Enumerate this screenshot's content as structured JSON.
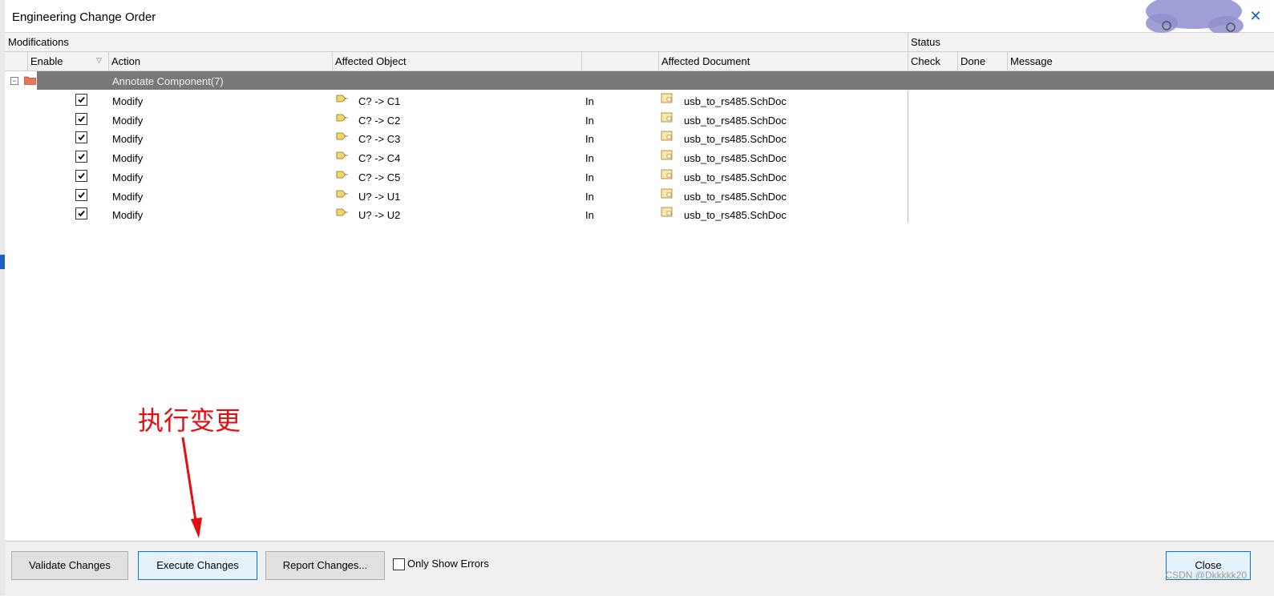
{
  "window": {
    "title": "Engineering Change Order"
  },
  "groups": {
    "modifications": "Modifications",
    "status": "Status"
  },
  "columns": {
    "enable": "Enable",
    "action": "Action",
    "affected_object": "Affected Object",
    "affected_document": "Affected Document",
    "check": "Check",
    "done": "Done",
    "message": "Message"
  },
  "group_row": {
    "label": "Annotate Component(7)",
    "expanded": true
  },
  "rows": [
    {
      "enabled": true,
      "action": "Modify",
      "object": "C? -> C1",
      "relation": "In",
      "document": "usb_to_rs485.SchDoc"
    },
    {
      "enabled": true,
      "action": "Modify",
      "object": "C? -> C2",
      "relation": "In",
      "document": "usb_to_rs485.SchDoc"
    },
    {
      "enabled": true,
      "action": "Modify",
      "object": "C? -> C3",
      "relation": "In",
      "document": "usb_to_rs485.SchDoc"
    },
    {
      "enabled": true,
      "action": "Modify",
      "object": "C? -> C4",
      "relation": "In",
      "document": "usb_to_rs485.SchDoc"
    },
    {
      "enabled": true,
      "action": "Modify",
      "object": "C? -> C5",
      "relation": "In",
      "document": "usb_to_rs485.SchDoc"
    },
    {
      "enabled": true,
      "action": "Modify",
      "object": "U? -> U1",
      "relation": "In",
      "document": "usb_to_rs485.SchDoc"
    },
    {
      "enabled": true,
      "action": "Modify",
      "object": "U? -> U2",
      "relation": "In",
      "document": "usb_to_rs485.SchDoc"
    }
  ],
  "footer": {
    "validate": "Validate Changes",
    "execute": "Execute Changes",
    "report": "Report Changes...",
    "only_show_errors": "Only Show Errors",
    "only_show_errors_checked": false,
    "close": "Close"
  },
  "annotation": {
    "text": "执行变更",
    "color": "#e01010"
  },
  "watermark": "CSDN @Dkkkkk20",
  "colors": {
    "group_row_bg": "#787878",
    "focus_border": "#0078d7",
    "accent": "#1f5fbf"
  }
}
